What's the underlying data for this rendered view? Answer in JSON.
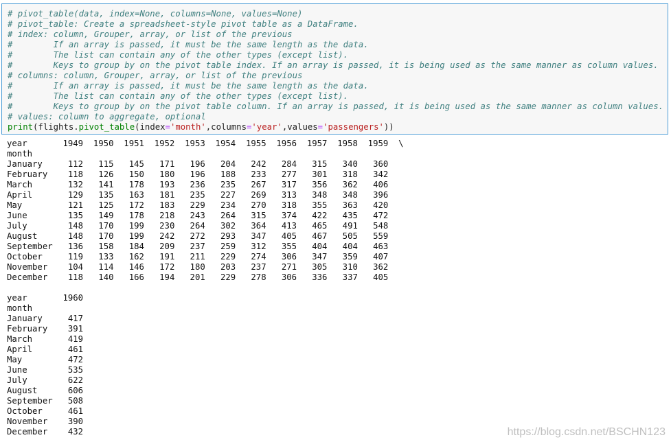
{
  "code_cell": {
    "comments": [
      "# pivot_table(data, index=None, columns=None, values=None)",
      "# pivot_table: Create a spreadsheet-style pivot table as a DataFrame.",
      "# index: column, Grouper, array, or list of the previous",
      "#        If an array is passed, it must be the same length as the data.",
      "#        The list can contain any of the other types (except list).",
      "#        Keys to group by on the pivot table index. If an array is passed, it is being used as the same manner as column values.",
      "# columns: column, Grouper, array, or list of the previous",
      "#        If an array is passed, it must be the same length as the data.",
      "#        The list can contain any of the other types (except list).",
      "#        Keys to group by on the pivot table column. If an array is passed, it is being used as the same manner as column values.",
      "# values: column to aggregate, optional"
    ],
    "print_tokens": [
      {
        "t": "print",
        "c": "tok-builtin"
      },
      {
        "t": "(flights.",
        "c": "tok-plain"
      },
      {
        "t": "pivot_table",
        "c": "tok-builtin"
      },
      {
        "t": "(index",
        "c": "tok-plain"
      },
      {
        "t": "=",
        "c": "tok-op"
      },
      {
        "t": "'month'",
        "c": "tok-str"
      },
      {
        "t": ",columns",
        "c": "tok-plain"
      },
      {
        "t": "=",
        "c": "tok-op"
      },
      {
        "t": "'year'",
        "c": "tok-str"
      },
      {
        "t": ",values",
        "c": "tok-plain"
      },
      {
        "t": "=",
        "c": "tok-op"
      },
      {
        "t": "'passengers'",
        "c": "tok-str"
      },
      {
        "t": "))",
        "c": "tok-plain"
      }
    ]
  },
  "output": {
    "columns_label": "year",
    "index_label": "month",
    "continuation": "\\",
    "months": [
      "January",
      "February",
      "March",
      "April",
      "May",
      "June",
      "July",
      "August",
      "September",
      "October",
      "November",
      "December"
    ],
    "block1": {
      "years": [
        "1949",
        "1950",
        "1951",
        "1952",
        "1953",
        "1954",
        "1955",
        "1956",
        "1957",
        "1958",
        "1959"
      ],
      "rows": [
        [
          112,
          115,
          145,
          171,
          196,
          204,
          242,
          284,
          315,
          340,
          360
        ],
        [
          118,
          126,
          150,
          180,
          196,
          188,
          233,
          277,
          301,
          318,
          342
        ],
        [
          132,
          141,
          178,
          193,
          236,
          235,
          267,
          317,
          356,
          362,
          406
        ],
        [
          129,
          135,
          163,
          181,
          235,
          227,
          269,
          313,
          348,
          348,
          396
        ],
        [
          121,
          125,
          172,
          183,
          229,
          234,
          270,
          318,
          355,
          363,
          420
        ],
        [
          135,
          149,
          178,
          218,
          243,
          264,
          315,
          374,
          422,
          435,
          472
        ],
        [
          148,
          170,
          199,
          230,
          264,
          302,
          364,
          413,
          465,
          491,
          548
        ],
        [
          148,
          170,
          199,
          242,
          272,
          293,
          347,
          405,
          467,
          505,
          559
        ],
        [
          136,
          158,
          184,
          209,
          237,
          259,
          312,
          355,
          404,
          404,
          463
        ],
        [
          119,
          133,
          162,
          191,
          211,
          229,
          274,
          306,
          347,
          359,
          407
        ],
        [
          104,
          114,
          146,
          172,
          180,
          203,
          237,
          271,
          305,
          310,
          362
        ],
        [
          118,
          140,
          166,
          194,
          201,
          229,
          278,
          306,
          336,
          337,
          405
        ]
      ]
    },
    "block2": {
      "years": [
        "1960"
      ],
      "rows": [
        [
          417
        ],
        [
          391
        ],
        [
          419
        ],
        [
          461
        ],
        [
          472
        ],
        [
          535
        ],
        [
          622
        ],
        [
          606
        ],
        [
          508
        ],
        [
          461
        ],
        [
          390
        ],
        [
          432
        ]
      ]
    }
  },
  "watermark": "https://blog.csdn.net/BSCHN123"
}
